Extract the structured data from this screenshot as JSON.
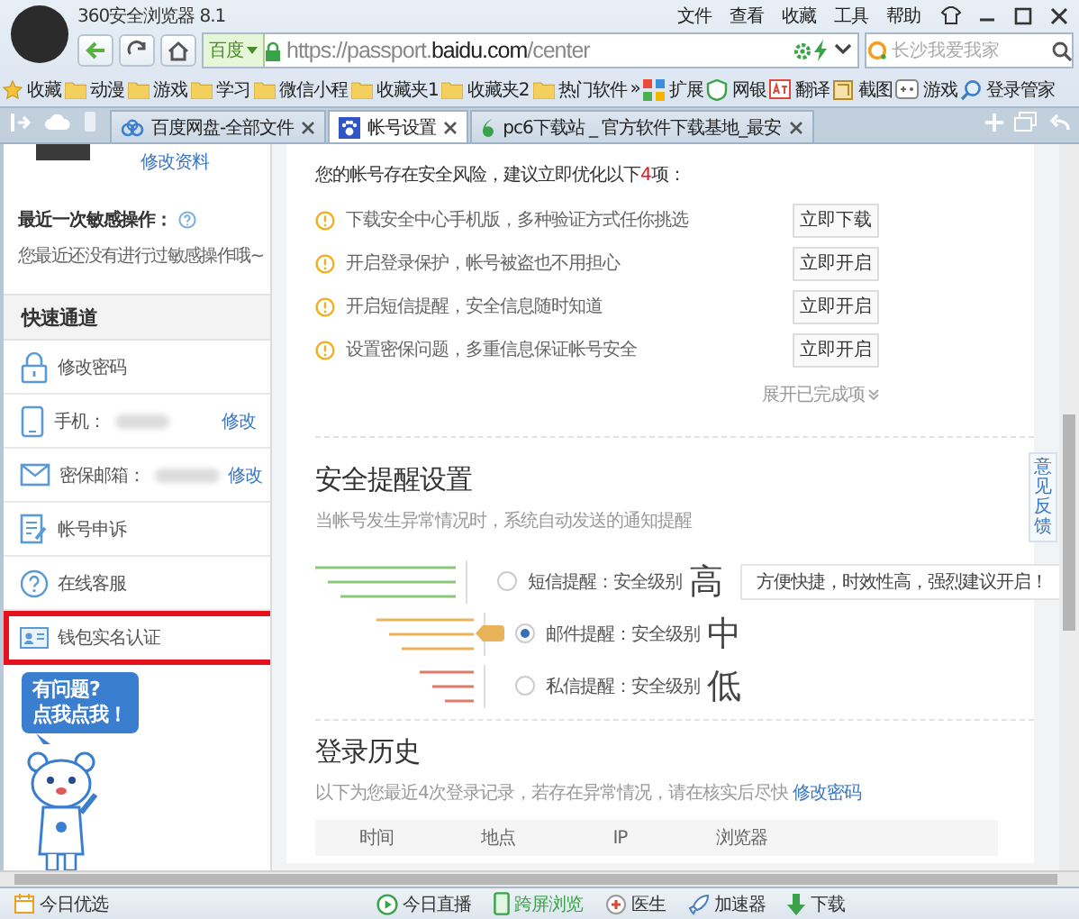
{
  "window": {
    "title": "360安全浏览器 8.1",
    "menu": [
      "文件",
      "查看",
      "收藏",
      "工具",
      "帮助"
    ]
  },
  "nav": {
    "search_engine": "百度",
    "url": "https://passport.**baidu.com**/center",
    "search_placeholder": "长沙我爱我家"
  },
  "bookmarks": [
    {
      "label": "收藏",
      "kind": "star"
    },
    {
      "label": "动漫",
      "kind": "folder"
    },
    {
      "label": "游戏",
      "kind": "folder"
    },
    {
      "label": "学习",
      "kind": "folder"
    },
    {
      "label": "微信小程",
      "kind": "folder"
    },
    {
      "label": "收藏夹1",
      "kind": "folder"
    },
    {
      "label": "收藏夹2",
      "kind": "folder"
    },
    {
      "label": "热门软件",
      "kind": "folder"
    },
    {
      "label": "»",
      "kind": "more"
    },
    {
      "label": "扩展",
      "kind": "extension"
    },
    {
      "label": "网银",
      "kind": "bank"
    },
    {
      "label": "翻译",
      "kind": "translate"
    },
    {
      "label": "截图",
      "kind": "screenshot"
    },
    {
      "label": "游戏",
      "kind": "game"
    },
    {
      "label": "登录管家",
      "kind": "login"
    }
  ],
  "tabs": [
    {
      "label": "百度网盘-全部文件",
      "selected": false,
      "kind": "cloud"
    },
    {
      "label": "帐号设置",
      "selected": true,
      "kind": "paw"
    },
    {
      "label": "pc6下载站 _ 官方软件下载基地_最安",
      "selected": false,
      "kind": "six"
    }
  ],
  "sidebar": {
    "profile_link": "修改资料",
    "recent_title": "最近一次敏感操作：",
    "recent_text": "您最近还没有进行过敏感操作哦~",
    "quick_title": "快速通道",
    "items": [
      {
        "label": "修改密码",
        "kind": "lock",
        "highlighted": false
      },
      {
        "label": "手机：",
        "kind": "phone",
        "action": "修改",
        "highlighted": false
      },
      {
        "label": "密保邮箱：",
        "kind": "mail",
        "action": "修改",
        "highlighted": false
      },
      {
        "label": "帐号申诉",
        "kind": "appeal",
        "highlighted": false
      },
      {
        "label": "在线客服",
        "kind": "help",
        "highlighted": false
      },
      {
        "label": "钱包实名认证",
        "kind": "card",
        "highlighted": true
      }
    ],
    "mascot_lines": [
      "有问题?",
      "点我点我！"
    ]
  },
  "risk": {
    "intro": "您的帐号存在安全风险，建议立即优化以下**4**项：",
    "items": [
      {
        "text": "下载安全中心手机版，多种验证方式任你挑选",
        "button": "立即下载"
      },
      {
        "text": "开启登录保护，帐号被盗也不用担心",
        "button": "立即开启"
      },
      {
        "text": "开启短信提醒，安全信息随时知道",
        "button": "立即开启"
      },
      {
        "text": "设置密保问题，多重信息保证帐号安全",
        "button": "立即开启"
      }
    ],
    "expand": "展开已完成项"
  },
  "alerts": {
    "title": "安全提醒设置",
    "subtitle": "当帐号发生异常情况时，系统自动发送的通知提醒",
    "options": [
      {
        "label": "短信提醒：安全级别",
        "level_text": "高",
        "color": "#8cc87a",
        "selected": false,
        "tip": "方便快捷，时效性高，强烈建议开启！"
      },
      {
        "label": "邮件提醒：安全级别",
        "level_text": "中",
        "color": "#e9b35a",
        "selected": true
      },
      {
        "label": "私信提醒：安全级别",
        "level_text": "低",
        "color": "#e07a6a",
        "selected": false
      }
    ]
  },
  "feedback": "意见反馈",
  "history": {
    "title": "登录历史",
    "note": "以下为您最近4次登录记录，若存在异常情况，请在核实后尽快",
    "link": "修改密码",
    "columns": [
      "时间",
      "地点",
      "IP",
      "浏览器"
    ]
  },
  "status_bar": {
    "left": "今日优选",
    "items": [
      {
        "label": "今日直播",
        "kind": "play"
      },
      {
        "label": "跨屏浏览",
        "kind": "screen"
      },
      {
        "label": "医生",
        "kind": "doctor"
      },
      {
        "label": "加速器",
        "kind": "rocket"
      },
      {
        "label": "下载",
        "kind": "download"
      }
    ]
  }
}
